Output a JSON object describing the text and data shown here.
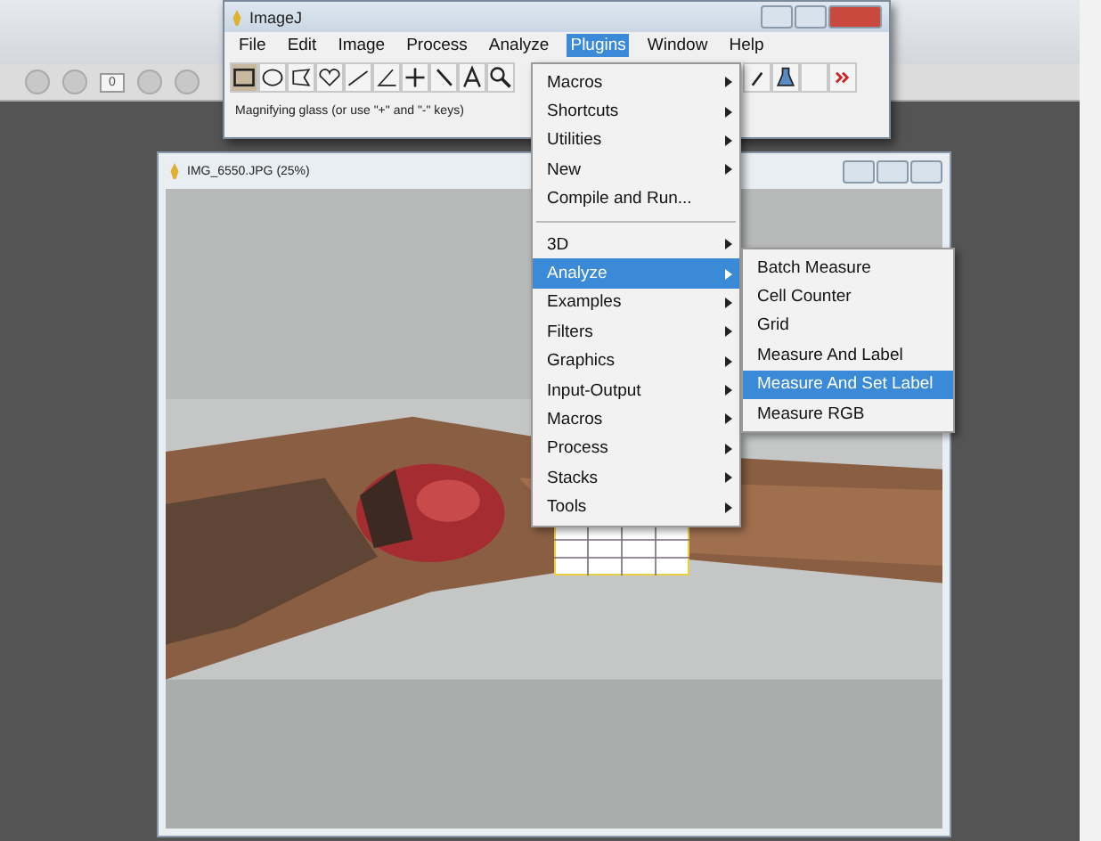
{
  "background_toolbar": {
    "field": "0"
  },
  "imagej": {
    "title": "ImageJ",
    "menus": [
      {
        "label": "File",
        "selected": false
      },
      {
        "label": "Edit",
        "selected": false
      },
      {
        "label": "Image",
        "selected": false
      },
      {
        "label": "Process",
        "selected": false
      },
      {
        "label": "Analyze",
        "selected": false
      },
      {
        "label": "Plugins",
        "selected": true
      },
      {
        "label": "Window",
        "selected": false
      },
      {
        "label": "Help",
        "selected": false
      }
    ],
    "status": "Magnifying glass (or use \"+\" and \"-\" keys)"
  },
  "plugins_menu": {
    "items": [
      {
        "kind": "item",
        "label": "Macros",
        "submenu": true,
        "selected": false
      },
      {
        "kind": "item",
        "label": "Shortcuts",
        "submenu": true,
        "selected": false
      },
      {
        "kind": "item",
        "label": "Utilities",
        "submenu": true,
        "selected": false
      },
      {
        "kind": "item",
        "label": "New",
        "submenu": true,
        "selected": false
      },
      {
        "kind": "item",
        "label": "Compile and Run...",
        "submenu": false,
        "selected": false
      },
      {
        "kind": "separator"
      },
      {
        "kind": "item",
        "label": "3D",
        "submenu": true,
        "selected": false
      },
      {
        "kind": "item",
        "label": "Analyze",
        "submenu": true,
        "selected": true
      },
      {
        "kind": "item",
        "label": "Examples",
        "submenu": true,
        "selected": false
      },
      {
        "kind": "item",
        "label": "Filters",
        "submenu": true,
        "selected": false
      },
      {
        "kind": "item",
        "label": "Graphics",
        "submenu": true,
        "selected": false
      },
      {
        "kind": "item",
        "label": "Input-Output",
        "submenu": true,
        "selected": false
      },
      {
        "kind": "item",
        "label": "Macros",
        "submenu": true,
        "selected": false
      },
      {
        "kind": "item",
        "label": "Process",
        "submenu": true,
        "selected": false
      },
      {
        "kind": "item",
        "label": "Stacks",
        "submenu": true,
        "selected": false
      },
      {
        "kind": "item",
        "label": "Tools",
        "submenu": true,
        "selected": false
      }
    ]
  },
  "analyze_submenu": {
    "items": [
      {
        "label": "Batch Measure",
        "selected": false
      },
      {
        "label": "Cell Counter",
        "selected": false
      },
      {
        "label": "Grid",
        "selected": false
      },
      {
        "label": "Measure And Label",
        "selected": false
      },
      {
        "label": "Measure And Set Label",
        "selected": true
      },
      {
        "label": "Measure RGB",
        "selected": false
      }
    ]
  },
  "image_window": {
    "title": "IMG_6550.JPG (25%)"
  }
}
